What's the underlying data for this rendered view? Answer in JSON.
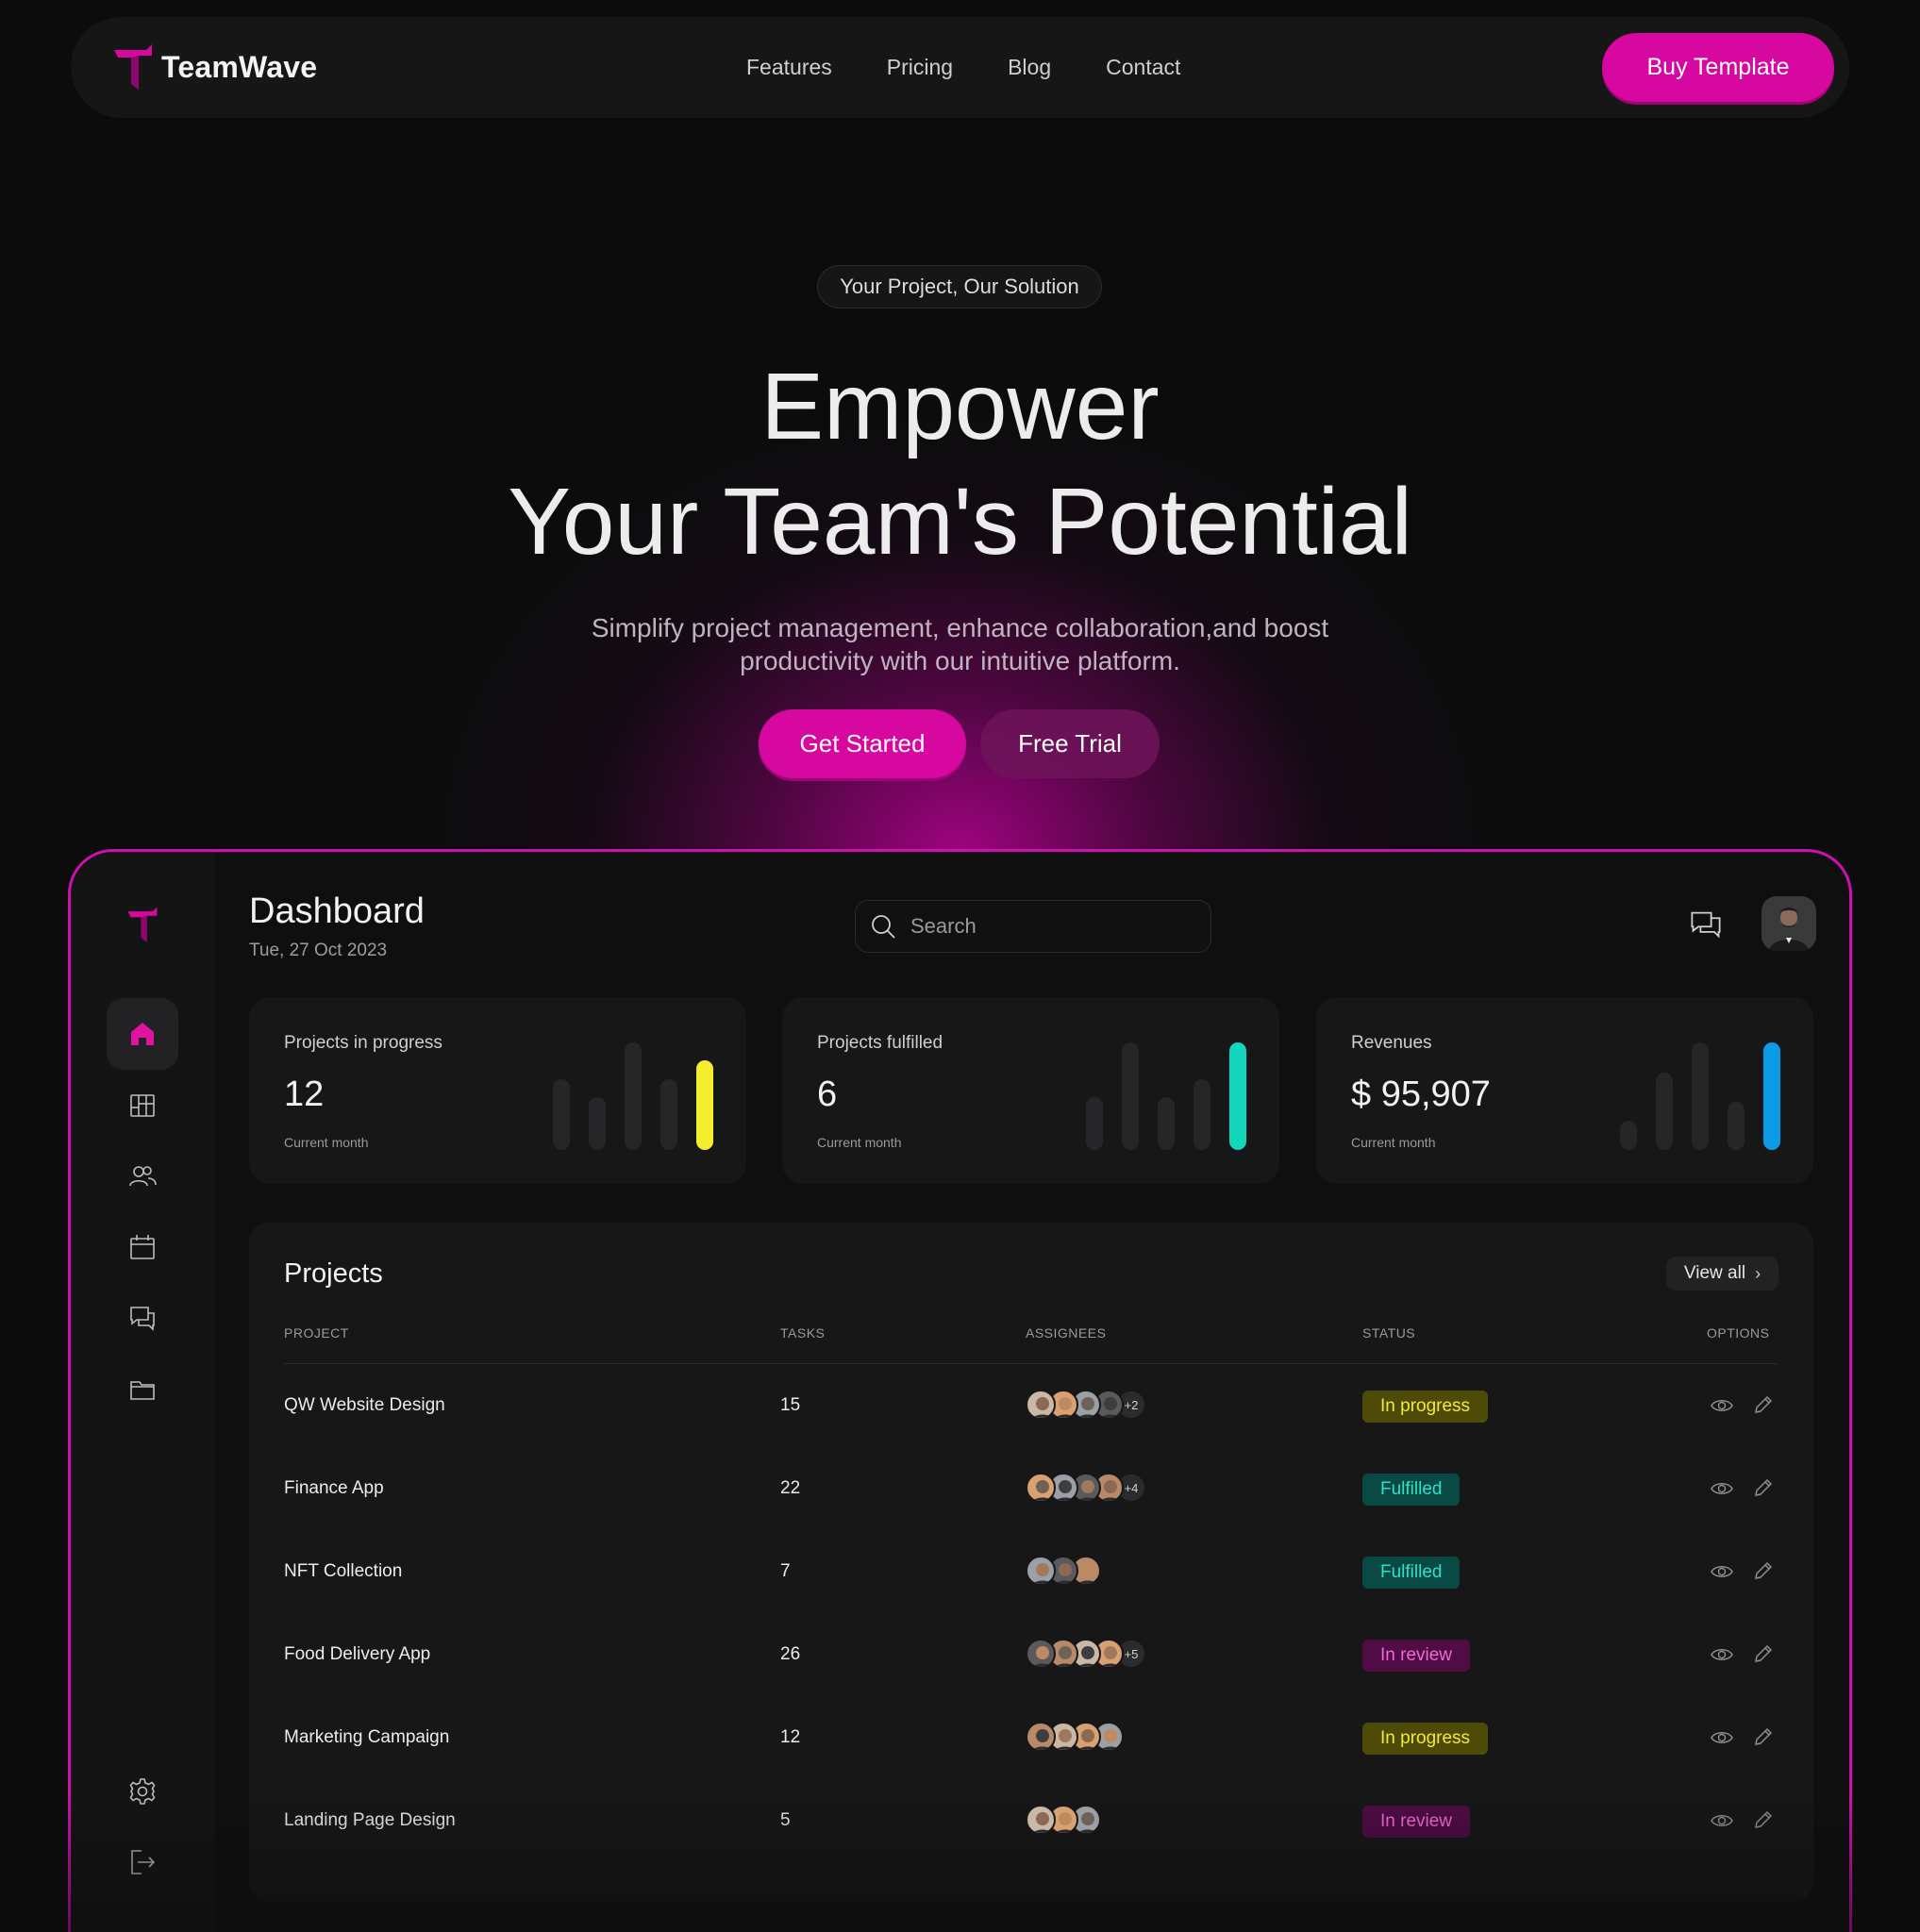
{
  "colors": {
    "accent": "#d6089f",
    "yellow": "#f5ee2e",
    "teal": "#14d6bc",
    "blue": "#0b9ae6",
    "background": "#0c0c0d"
  },
  "nav": {
    "brand": "TeamWave",
    "links": [
      "Features",
      "Pricing",
      "Blog",
      "Contact"
    ],
    "buy_label": "Buy Template"
  },
  "hero": {
    "pill": "Your Project, Our Solution",
    "title_line1": "Empower",
    "title_line2": "Your Team's Potential",
    "subtitle_line1": "Simplify project management, enhance collaboration,and boost",
    "subtitle_line2": "productivity with our intuitive platform.",
    "primary_cta": "Get Started",
    "secondary_cta": "Free Trial"
  },
  "sidebar": {
    "items": [
      {
        "icon": "home-icon",
        "active": true
      },
      {
        "icon": "board-icon",
        "active": false
      },
      {
        "icon": "users-icon",
        "active": false
      },
      {
        "icon": "calendar-icon",
        "active": false
      },
      {
        "icon": "chat-icon",
        "active": false
      },
      {
        "icon": "folder-icon",
        "active": false
      }
    ],
    "bottom": [
      "settings-icon",
      "logout-icon"
    ]
  },
  "dashboard": {
    "title": "Dashboard",
    "date": "Tue, 27 Oct 2023",
    "search_placeholder": "Search"
  },
  "stats": [
    {
      "label": "Projects in progress",
      "value": "12",
      "sub": "Current month",
      "bars": [
        0.66,
        0.49,
        1.0,
        0.66,
        0.83
      ],
      "highlight": "#f5ee2e"
    },
    {
      "label": "Projects fulfilled",
      "value": "6",
      "sub": "Current month",
      "bars": [
        0.49,
        1.0,
        0.49,
        0.66,
        1.0
      ],
      "highlight": "#14d6bc"
    },
    {
      "label": "Revenues",
      "value": "$ 95,907",
      "sub": "Current month",
      "bars": [
        0.27,
        0.72,
        1.0,
        0.45,
        1.0
      ],
      "highlight": "#0b9ae6"
    }
  ],
  "projects": {
    "title": "Projects",
    "view_all": "View all",
    "headers": [
      "PROJECT",
      "TASKS",
      "ASSIGNEES",
      "STATUS",
      "OPTIONS"
    ],
    "rows": [
      {
        "name": "QW Website Design",
        "tasks": "15",
        "avatars": 4,
        "more": "+2",
        "status": "In progress",
        "kind": "progress"
      },
      {
        "name": "Finance App",
        "tasks": "22",
        "avatars": 4,
        "more": "+4",
        "status": "Fulfilled",
        "kind": "fulfilled"
      },
      {
        "name": "NFT Collection",
        "tasks": "7",
        "avatars": 3,
        "more": "",
        "status": "Fulfilled",
        "kind": "fulfilled"
      },
      {
        "name": "Food Delivery App",
        "tasks": "26",
        "avatars": 4,
        "more": "+5",
        "status": "In review",
        "kind": "review"
      },
      {
        "name": "Marketing Campaign",
        "tasks": "12",
        "avatars": 4,
        "more": "",
        "status": "In progress",
        "kind": "progress"
      },
      {
        "name": "Landing Page Design",
        "tasks": "5",
        "avatars": 3,
        "more": "",
        "status": "In review",
        "kind": "review"
      }
    ]
  }
}
